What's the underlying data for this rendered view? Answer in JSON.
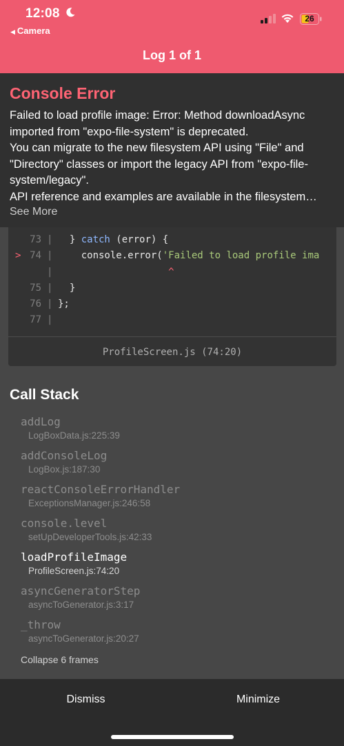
{
  "status_bar": {
    "time": "12:08",
    "back_label": "Camera",
    "battery": "26"
  },
  "header": {
    "title": "Log 1 of 1"
  },
  "error": {
    "title": "Console Error",
    "message_lines": [
      "Failed to load profile image: Error: Method downloadAsync",
      "imported from \"expo-file-system\" is deprecated.",
      "You can migrate to the new filesystem API using \"File\" and",
      "\"Directory\" classes or import the legacy API from \"expo-file-",
      "system/legacy\".",
      "API reference and examples are available in the filesystem…"
    ],
    "see_more": "See More"
  },
  "code_frame": {
    "lines": [
      {
        "num": "73",
        "marker": "",
        "indent": "  ",
        "parts": [
          [
            "",
            "} "
          ],
          [
            "kw",
            "catch"
          ],
          [
            "",
            " (error) {"
          ]
        ]
      },
      {
        "num": "74",
        "marker": ">",
        "indent": "    ",
        "parts": [
          [
            "",
            "console.error("
          ],
          [
            "str",
            "'Failed to load profile ima"
          ]
        ]
      },
      {
        "num": "",
        "marker": "",
        "indent": "",
        "parts": [
          [
            "caret",
            "                   ^"
          ]
        ]
      },
      {
        "num": "75",
        "marker": "",
        "indent": "  ",
        "parts": [
          [
            "",
            "}"
          ]
        ]
      },
      {
        "num": "76",
        "marker": "",
        "indent": "",
        "parts": [
          [
            "",
            "};"
          ]
        ]
      },
      {
        "num": "77",
        "marker": "",
        "indent": "",
        "parts": []
      }
    ],
    "file": "ProfileScreen.js (74:20)"
  },
  "call_stack": {
    "title": "Call Stack",
    "frames": [
      {
        "fn": "addLog",
        "loc": "LogBoxData.js:225:39",
        "active": false
      },
      {
        "fn": "addConsoleLog",
        "loc": "LogBox.js:187:30",
        "active": false
      },
      {
        "fn": "reactConsoleErrorHandler",
        "loc": "ExceptionsManager.js:246:58",
        "active": false
      },
      {
        "fn": "console.level",
        "loc": "setUpDeveloperTools.js:42:33",
        "active": false
      },
      {
        "fn": "loadProfileImage",
        "loc": "ProfileScreen.js:74:20",
        "active": true
      },
      {
        "fn": "asyncGeneratorStep",
        "loc": "asyncToGenerator.js:3:17",
        "active": false
      },
      {
        "fn": "_throw",
        "loc": "asyncToGenerator.js:20:27",
        "active": false
      }
    ],
    "collapse_label": "Collapse 6 frames"
  },
  "bottom_bar": {
    "dismiss_label": "Dismiss",
    "minimize_label": "Minimize"
  },
  "colors": {
    "header_bg": "#ef5a6f",
    "error_title": "#ff6474",
    "keyword": "#8fb8ff",
    "string": "#a9c97a"
  },
  "icons": [
    "moon-icon",
    "back-triangle-icon",
    "cellular-signal-icon",
    "wifi-icon",
    "battery-icon"
  ]
}
